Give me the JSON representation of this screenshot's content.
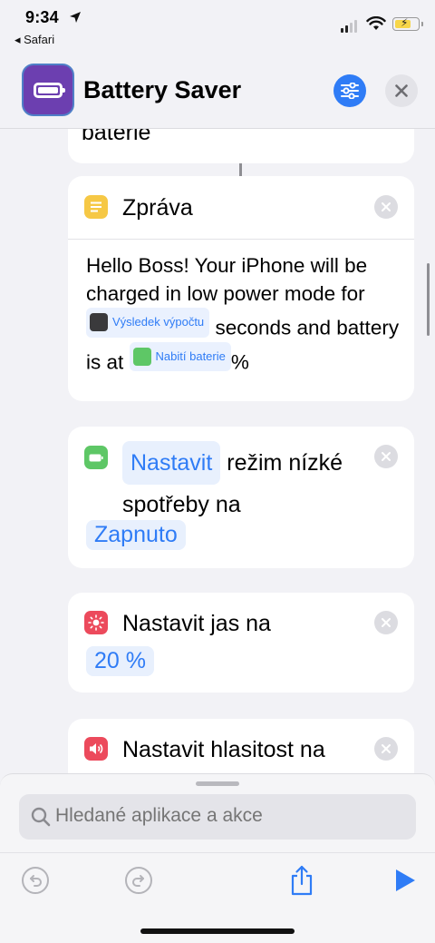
{
  "status_bar": {
    "time": "9:34",
    "back_app": "◂ Safari"
  },
  "header": {
    "title": "Battery Saver",
    "app_icon": "battery-icon",
    "accent_color": "#2f7cf6",
    "app_icon_color": "#6c3fb0"
  },
  "cards": {
    "partial_top": {
      "text": "baterie"
    },
    "message": {
      "title": "Zpráva",
      "body_1": "Hello Boss! Your iPhone will be charged in low power mode for",
      "token_1": "Výsledek výpočtu",
      "body_2": "seconds and battery is at",
      "token_2": "Nabití baterie",
      "body_3": "%"
    },
    "low_power": {
      "token_action": "Nastavit",
      "text": "režim nízké spotřeby na",
      "token_value": "Zapnuto"
    },
    "brightness": {
      "text": "Nastavit jas na",
      "token_value": "20 %"
    },
    "volume": {
      "text": "Nastavit hlasitost na"
    }
  },
  "search": {
    "placeholder": "Hledané aplikace a akce"
  },
  "toolbar": {
    "undo": "undo-icon",
    "redo": "redo-icon",
    "share": "share-icon",
    "run": "play-icon"
  }
}
